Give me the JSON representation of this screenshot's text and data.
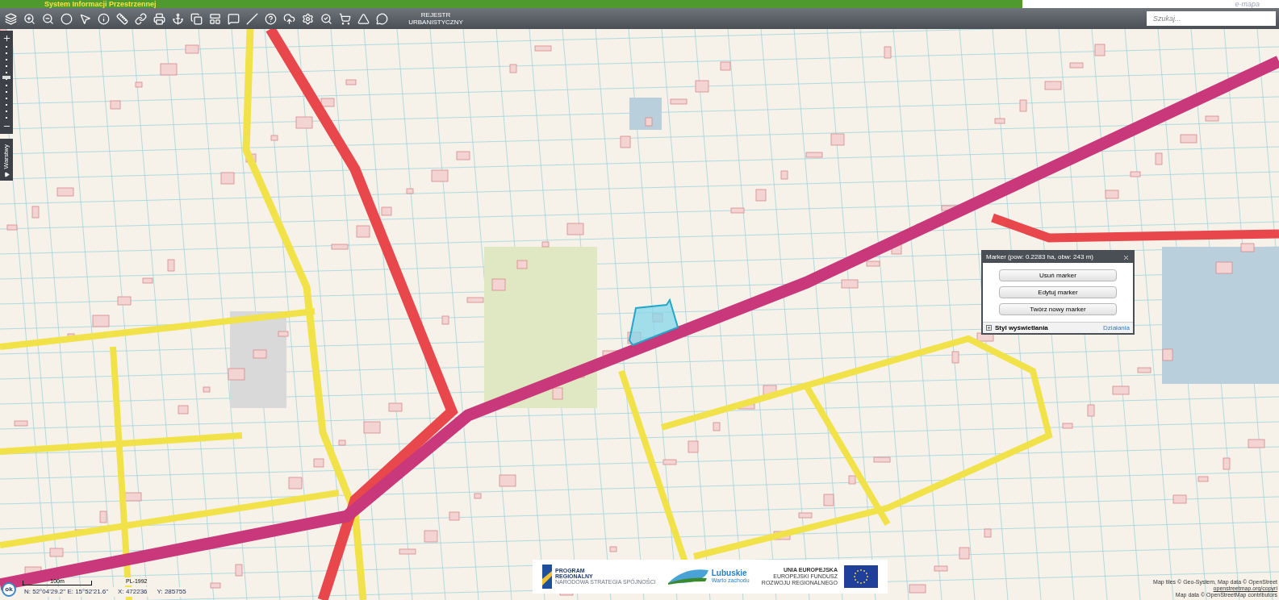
{
  "header": {
    "title": "System Informacji Przestrzennej",
    "logo_text": "e-mapa"
  },
  "toolbar": {
    "register_button": "REJESTR URBANISTYCZNY",
    "search": {
      "placeholder": "Szukaj..."
    }
  },
  "side": {
    "layers_tab": "Warstwy",
    "zoom_slider": {
      "level": 0.55
    }
  },
  "popup": {
    "title": "Marker (pow: 0.2283 ha, obw: 243 m)",
    "buttons": [
      "Usuń marker",
      "Edytuj marker",
      "Twórz nowy marker"
    ],
    "style_toggle": "Styl wyświetlania",
    "actions_link": "Działania"
  },
  "status": {
    "ok_button": "ok",
    "scale": "100m",
    "projection": "PL-1992",
    "latlon": "N: 52°04'29.2\" E: 15°52'21.6\"",
    "x": "X: 472236",
    "y": "Y: 285755"
  },
  "banner": {
    "program": [
      "PROGRAM",
      "REGIONALNY"
    ],
    "program_sub": "NARODOWA STRATEGIA SPÓJNOŚCI",
    "region": "Lubuskie",
    "region_sub": "Warto zachodu",
    "eu": [
      "UNIA EUROPEJSKA",
      "EUROPEJSKI FUNDUSZ",
      "ROZWOJU REGIONALNEGO"
    ]
  },
  "attribution": [
    "Map tiles © Geo-System, Map data © OpenStreet",
    "openstreetmap.org/copyri",
    "Map data © OpenStreetMap contributors"
  ]
}
